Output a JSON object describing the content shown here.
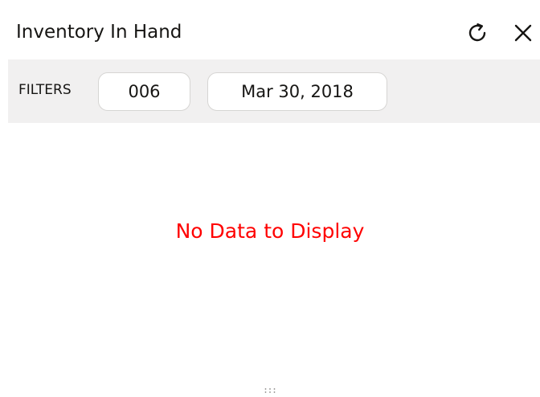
{
  "widget": {
    "title": "Inventory In Hand",
    "icons": {
      "refresh": "refresh-icon",
      "close": "close-icon",
      "resize": "resize-handle-icon"
    }
  },
  "filters": {
    "label": "FILTERS",
    "branch": "006",
    "date": "Mar 30, 2018"
  },
  "empty_state": {
    "message": "No Data to Display"
  },
  "colors": {
    "filter_bar_bg": "#f1f0f0",
    "empty_message": "#ff0000",
    "text": "#161513"
  }
}
